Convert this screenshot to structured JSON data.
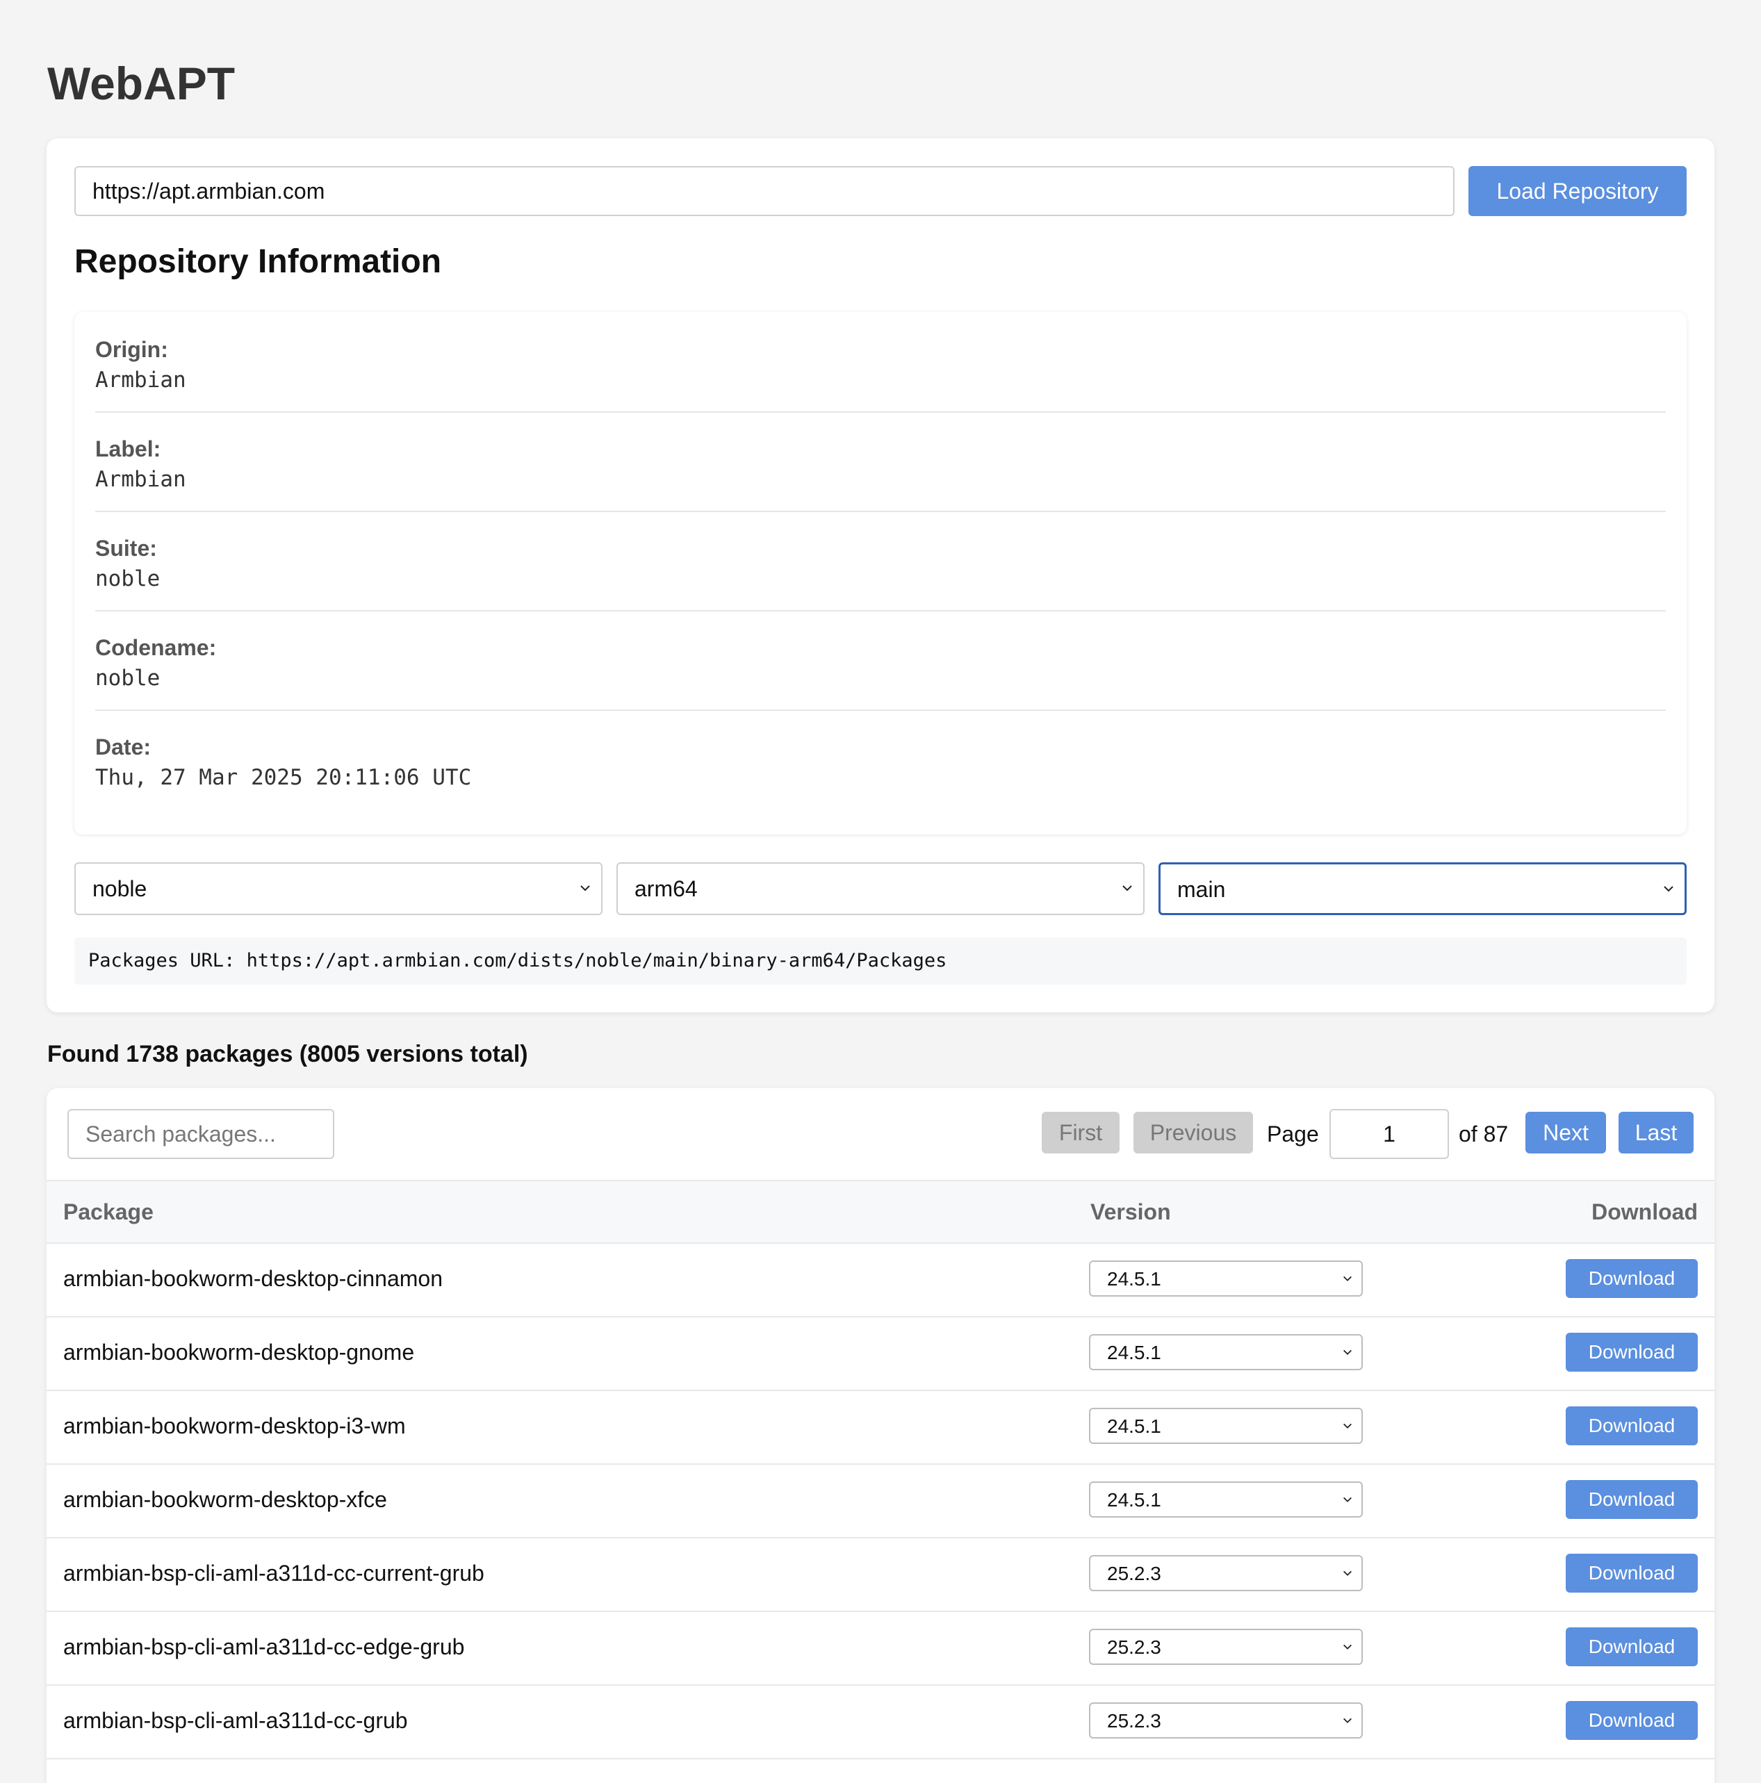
{
  "app": {
    "title": "WebAPT"
  },
  "repo": {
    "url": "https://apt.armbian.com",
    "load_label": "Load Repository",
    "section_title": "Repository Information",
    "info": [
      {
        "label": "Origin:",
        "value": "Armbian"
      },
      {
        "label": "Label:",
        "value": "Armbian"
      },
      {
        "label": "Suite:",
        "value": "noble"
      },
      {
        "label": "Codename:",
        "value": "noble"
      },
      {
        "label": "Date:",
        "value": "Thu, 27 Mar 2025 20:11:06 UTC"
      }
    ],
    "selects": {
      "distribution": "noble",
      "architecture": "arm64",
      "component": "main"
    },
    "packages_url": "Packages URL: https://apt.armbian.com/dists/noble/main/binary-arm64/Packages"
  },
  "summary": "Found 1738 packages (8005 versions total)",
  "packages": {
    "search_placeholder": "Search packages...",
    "pagination": {
      "first": "First",
      "previous": "Previous",
      "page_label": "Page",
      "current_page": "1",
      "of_label": "of 87",
      "next": "Next",
      "last": "Last"
    },
    "columns": {
      "package": "Package",
      "version": "Version",
      "download": "Download"
    },
    "download_label": "Download",
    "rows": [
      {
        "name": "armbian-bookworm-desktop-cinnamon",
        "version": "24.5.1"
      },
      {
        "name": "armbian-bookworm-desktop-gnome",
        "version": "24.5.1"
      },
      {
        "name": "armbian-bookworm-desktop-i3-wm",
        "version": "24.5.1"
      },
      {
        "name": "armbian-bookworm-desktop-xfce",
        "version": "24.5.1"
      },
      {
        "name": "armbian-bsp-cli-aml-a311d-cc-current-grub",
        "version": "25.2.3"
      },
      {
        "name": "armbian-bsp-cli-aml-a311d-cc-edge-grub",
        "version": "25.2.3"
      },
      {
        "name": "armbian-bsp-cli-aml-a311d-cc-grub",
        "version": "25.2.3"
      }
    ]
  }
}
